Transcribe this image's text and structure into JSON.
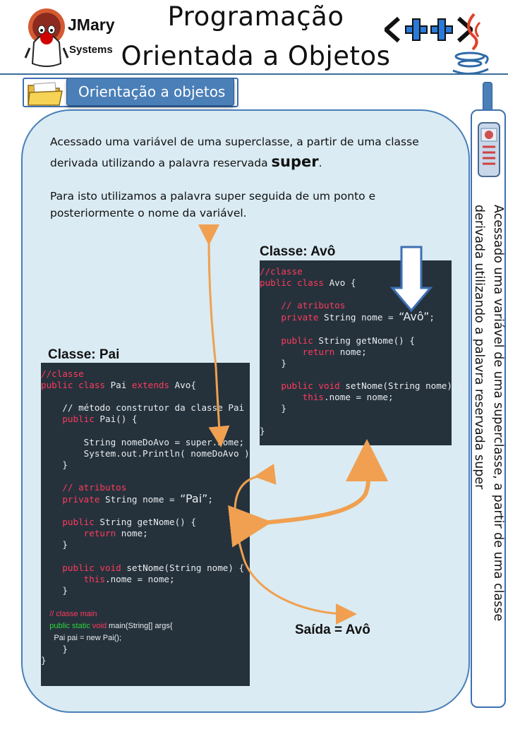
{
  "header": {
    "logo_name": "JMary",
    "logo_sub": "Systems",
    "title_line1": "Programação",
    "title_line2": "Orientada a Objetos",
    "icons": [
      "mascot-logo-icon",
      "cpp-icon",
      "java-icon",
      "folder-icon",
      "newspaper-icon"
    ]
  },
  "section": {
    "label": "Orientação a objetos"
  },
  "intro": {
    "line1_before": "Acessado uma variável de uma superclasse, a partir de uma classe derivada utilizando a palavra reservada ",
    "line1_bold": "super",
    "line1_after": ".",
    "paragraph2": "Para isto utilizamos a palavra super seguida de um ponto e posteriormente o nome da variável."
  },
  "avo": {
    "label": "Classe: Avô",
    "lines": {
      "l1": "//classe",
      "l2": "public class Avo {",
      "l3": "    // atributos",
      "l4_pre": "    private String nome = ",
      "l4_str": "“Avô”",
      "l4_post": ";",
      "l5": "    public String getNome() {",
      "l6": "        return nome;",
      "l7": "    }",
      "l8": "    public void setNome(String nome) {",
      "l9": "        this.nome = nome;",
      "l10": "    }",
      "l11": "}"
    }
  },
  "pai": {
    "label": "Classe: Pai",
    "lines": {
      "l1": "//classe",
      "l2": "public class Pai extends Avo{",
      "l3": "    // método construtor da classe Pai",
      "l4": "    public Pai() {",
      "l5": "        String nomeDoAvo = super.nome;",
      "l6": "        System.out.Println( nomeDoAvo );",
      "l7": "    }",
      "l8": "    // atributos",
      "l9_pre": "    private String nome = ",
      "l9_str": "“Pai”",
      "l9_post": ";",
      "l10": "    public String getNome() {",
      "l11": "        return nome;",
      "l12": "    }",
      "l13": "    public void setNome(String nome) {",
      "l14": "        this.nome = nome;",
      "l15": "    }",
      "l16": "    // classe main",
      "l17_a": "    public static ",
      "l17_b": "void",
      "l17_c": " main(String[] args{",
      "l18": "      Pai pai = new Pai();",
      "l19": "    }",
      "l20": "}"
    }
  },
  "output_label": "Saída = Avô",
  "side_text": "Acessado uma variável de uma superclasse, a partir de uma classe derivada utilizando a palavra reservada super",
  "colors": {
    "accent": "#4a7fb8",
    "panel": "#daebf3",
    "code_bg": "#25323c",
    "arrow": "#f0a050"
  }
}
